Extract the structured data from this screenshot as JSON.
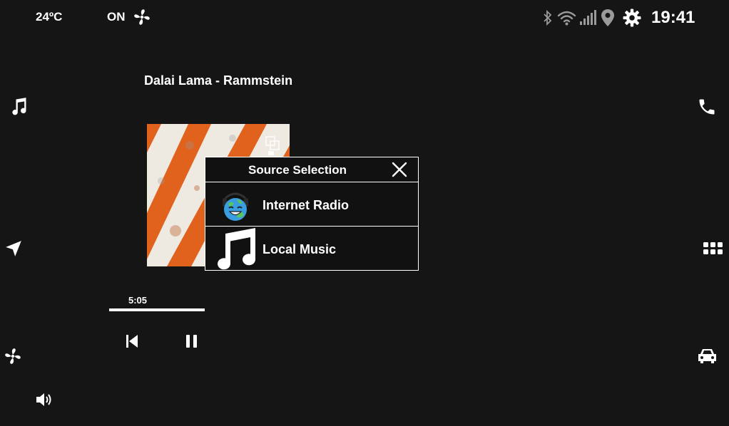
{
  "status": {
    "temperature": "24ºC",
    "fan_state": "ON",
    "time": "19:41"
  },
  "icons": {
    "fan": "fan-icon",
    "bluetooth": "bluetooth-icon",
    "wifi": "wifi-icon",
    "signal": "signal-icon",
    "location": "location-pin-icon",
    "settings": "gear-icon",
    "music": "music-note-icon",
    "navigation": "navigation-arrow-icon",
    "phone": "phone-icon",
    "apps": "app-grid-icon",
    "car": "car-icon",
    "volume": "volume-icon",
    "previous": "skip-previous-icon",
    "pause": "pause-icon"
  },
  "player": {
    "track_title": "Dalai Lama - Rammstein",
    "time_remaining": "5:05",
    "progress": 1.0
  },
  "source_popup": {
    "title": "Source Selection",
    "options": [
      {
        "label": "Internet Radio",
        "icon": "radio-globe-icon"
      },
      {
        "label": "Local Music",
        "icon": "music-note-icon"
      }
    ]
  },
  "colors": {
    "background": "#151515",
    "foreground": "#ffffff",
    "album_orange": "#e0621c",
    "icon_grey": "#9a9a9a"
  }
}
